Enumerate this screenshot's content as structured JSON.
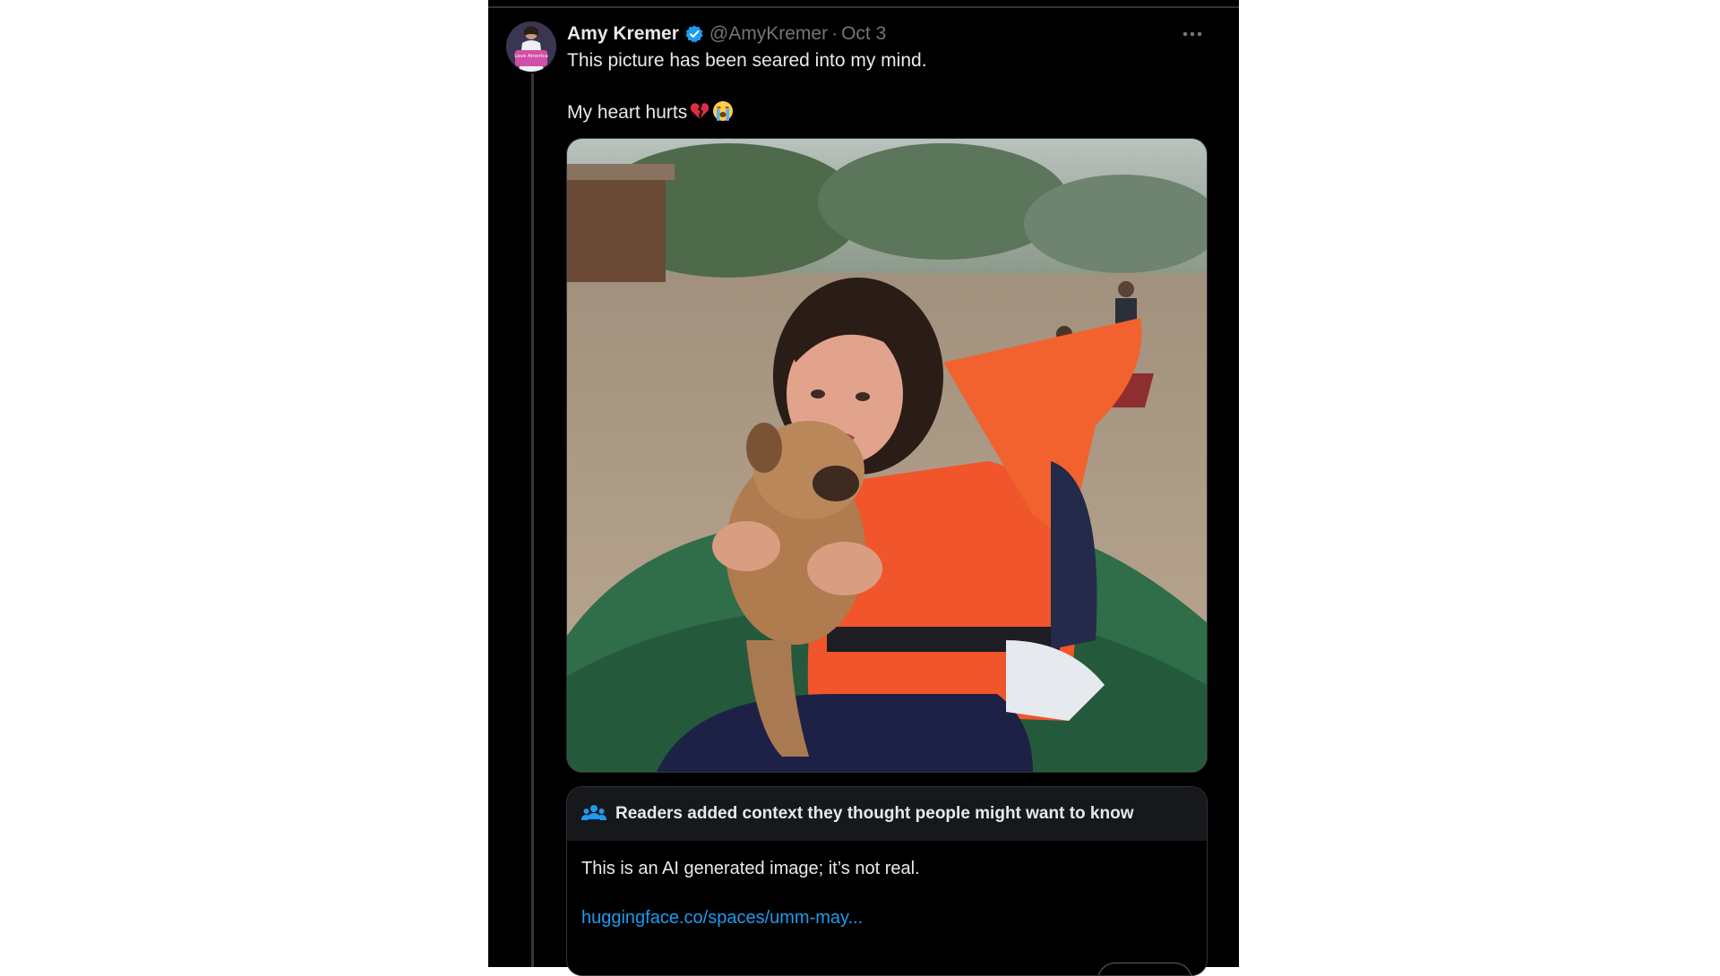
{
  "tweet": {
    "author_name": "Amy Kremer",
    "handle": "@AmyKremer",
    "separator": "·",
    "date": "Oct 3",
    "line1": "This picture has been seared into my mind.",
    "line2": "My heart hurts",
    "line2_emojis": [
      "broken-heart-emoji",
      "loudly-crying-face-emoji"
    ],
    "verified_color": "#1d9bf0",
    "more_icon": "more-horizontal-icon",
    "avatar_text": "Love America"
  },
  "community_note": {
    "icon": "people-icon",
    "title": "Readers added context they thought people might want to know",
    "text": "This is an AI generated image; it’s not real.",
    "link": "huggingface.co/spaces/umm-may..."
  },
  "colors": {
    "background": "#000000",
    "text": "#e7e9ea",
    "muted": "#71767b",
    "accent": "#1d9bf0",
    "note_header": "#16181c"
  }
}
